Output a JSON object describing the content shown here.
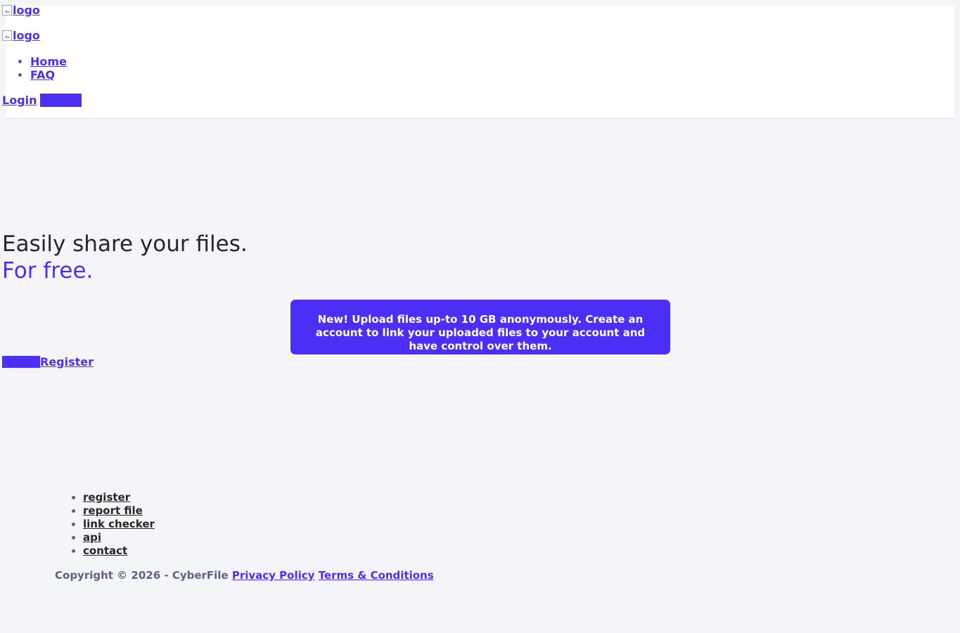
{
  "header": {
    "top_logo_alt": "logo",
    "main_logo_alt": "logo",
    "nav": [
      {
        "label": "Home"
      },
      {
        "label": "FAQ"
      }
    ],
    "login_label": "Login"
  },
  "hero": {
    "title": "Easily share your files.",
    "subtitle": "For free.",
    "notice_badge": "New!",
    "notice_text": " Upload files up-to 10 GB anonymously. Create an account to link your uploaded files to your account and have control over them.",
    "register_label": "Register"
  },
  "footer": {
    "links": [
      {
        "label": "register"
      },
      {
        "label": "report file"
      },
      {
        "label": "link checker"
      },
      {
        "label": "api"
      },
      {
        "label": "contact"
      }
    ],
    "copyright": "Copyright © 2026 - CyberFile",
    "privacy_label": "Privacy Policy",
    "terms_label": "Terms & Conditions"
  },
  "colors": {
    "brand": "#4b2ff5",
    "background": "#f4f5f8",
    "text_dark": "#262626",
    "text_muted": "#5a6480"
  }
}
